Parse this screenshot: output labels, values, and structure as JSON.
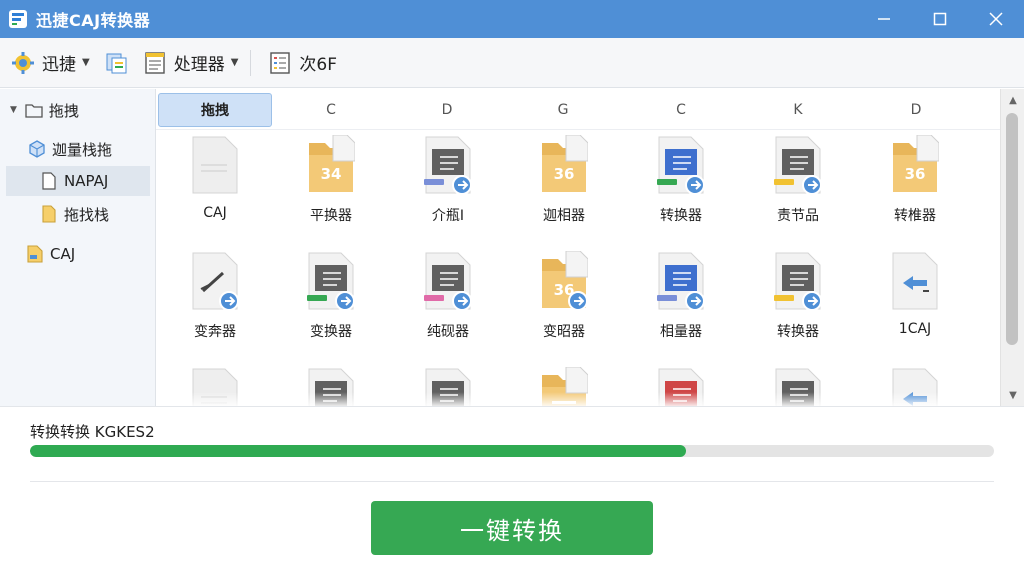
{
  "window": {
    "title": "迅捷CAJ转换器",
    "controls": {
      "minimize": "minimize-icon",
      "maximize": "maximize-icon",
      "close": "close-icon"
    }
  },
  "toolbar": {
    "items": [
      {
        "label": "迅捷",
        "icon": "gear-icon",
        "dropdown": true
      },
      {
        "label": "处理器",
        "icon": "document-icon",
        "dropdown": true
      },
      {
        "label": "次6F",
        "icon": "list-icon",
        "dropdown": false
      }
    ],
    "extra_icon": "pages-icon"
  },
  "sidebar": {
    "root": {
      "label": "拖拽",
      "icon": "folder-icon",
      "expanded": true
    },
    "items": [
      {
        "label": "迦量栈拖",
        "icon": "cube-icon",
        "selected": false
      },
      {
        "label": "NAPAJ",
        "icon": "page-icon",
        "selected": true
      },
      {
        "label": "拖找栈",
        "icon": "folder-icon",
        "selected": false
      },
      {
        "label": "CAJ",
        "icon": "caj-file-icon",
        "selected": false
      }
    ]
  },
  "grid": {
    "columns": [
      {
        "label": "拖拽",
        "active": true
      },
      {
        "label": "C",
        "active": false
      },
      {
        "label": "D",
        "active": false
      },
      {
        "label": "G",
        "active": false
      },
      {
        "label": "C",
        "active": false
      },
      {
        "label": "K",
        "active": false
      },
      {
        "label": "D",
        "active": false
      }
    ],
    "rows": [
      [
        {
          "label": "CAJ",
          "type": "blank",
          "badge": "",
          "arrow": false
        },
        {
          "label": "平换器",
          "type": "folder",
          "badge": "34",
          "arrow": false
        },
        {
          "label": "介瓶I",
          "type": "doc",
          "stripe": "#7a8fd8",
          "arrow": true
        },
        {
          "label": "迦相器",
          "type": "folder",
          "badge": "36",
          "arrow": false
        },
        {
          "label": "转换器",
          "type": "blue-doc",
          "stripe": "#36a853",
          "arrow": true
        },
        {
          "label": "责节品",
          "type": "doc",
          "stripe": "#f1c232",
          "arrow": true
        },
        {
          "label": "转椎器",
          "type": "folder",
          "badge": "36",
          "arrow": false
        }
      ],
      [
        {
          "label": "变奔器",
          "type": "pen",
          "arrow": true
        },
        {
          "label": "变换器",
          "type": "doc",
          "stripe": "#36a853",
          "arrow": true
        },
        {
          "label": "纯砚器",
          "type": "doc",
          "stripe": "#e06aa8",
          "arrow": true
        },
        {
          "label": "变昭器",
          "type": "folder",
          "badge": "36",
          "arrow": true
        },
        {
          "label": "相量器",
          "type": "blue-doc",
          "stripe": "#7a8fd8",
          "arrow": true
        },
        {
          "label": "转换器",
          "type": "doc",
          "stripe": "#f1c232",
          "arrow": true
        },
        {
          "label": "1CAJ",
          "type": "caj",
          "arrow": false
        }
      ],
      [
        {
          "label": "",
          "type": "blank",
          "arrow": false
        },
        {
          "label": "",
          "type": "doc",
          "stripe": "#36a853",
          "arrow": false
        },
        {
          "label": "",
          "type": "doc",
          "stripe": "#7a8fd8",
          "arrow": false
        },
        {
          "label": "",
          "type": "folder",
          "badge": "",
          "arrow": false
        },
        {
          "label": "",
          "type": "red-doc",
          "stripe": "#d9534f",
          "arrow": false
        },
        {
          "label": "",
          "type": "doc",
          "stripe": "#f1c232",
          "arrow": false
        },
        {
          "label": "",
          "type": "caj",
          "arrow": false
        }
      ]
    ]
  },
  "progress": {
    "label": "转换转换 KGKES2",
    "value": 0.68,
    "color": "#2faa52"
  },
  "action": {
    "convert_label": "一键转换",
    "color": "#36a853"
  }
}
